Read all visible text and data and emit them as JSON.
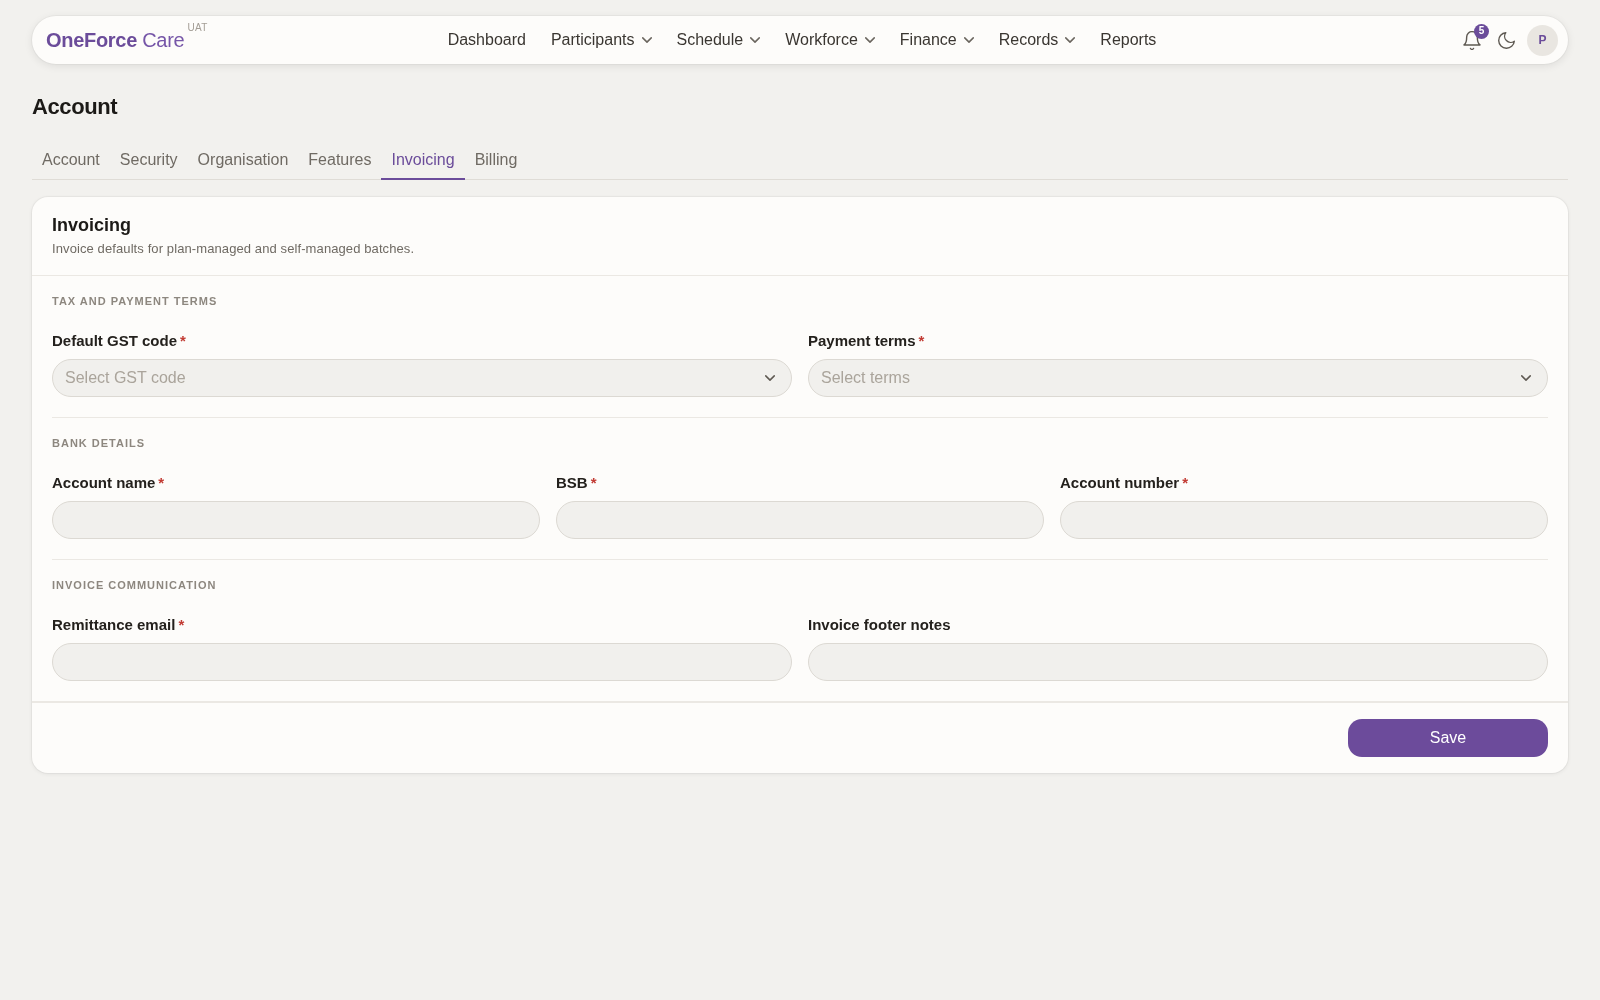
{
  "header": {
    "logo": "**OneForce** Care",
    "environment": "UAT",
    "nav": [
      {
        "label": "Dashboard",
        "has_menu": false
      },
      {
        "label": "Participants",
        "has_menu": true
      },
      {
        "label": "Schedule",
        "has_menu": true
      },
      {
        "label": "Workforce",
        "has_menu": true
      },
      {
        "label": "Finance",
        "has_menu": true
      },
      {
        "label": "Records",
        "has_menu": true
      },
      {
        "label": "Reports",
        "has_menu": false
      }
    ],
    "notification_count": "5",
    "avatar_initial": "P"
  },
  "page": {
    "title": "Account"
  },
  "tabs": [
    {
      "label": "Account",
      "selected": false
    },
    {
      "label": "Security",
      "selected": false
    },
    {
      "label": "Organisation",
      "selected": false
    },
    {
      "label": "Features",
      "selected": false
    },
    {
      "label": "Invoicing",
      "selected": true
    },
    {
      "label": "Billing",
      "selected": false
    }
  ],
  "card": {
    "title": "Invoicing",
    "description": "Invoice defaults for plan-managed and self-managed batches.",
    "sections": [
      {
        "heading": "TAX AND PAYMENT TERMS",
        "fields": [
          {
            "label": "Default GST code",
            "required_mark": "*",
            "kind": "select",
            "placeholder": "Select GST code"
          },
          {
            "label": "Payment terms",
            "required_mark": "*",
            "kind": "select",
            "placeholder": "Select terms"
          }
        ]
      },
      {
        "heading": "BANK DETAILS",
        "fields": [
          {
            "label": "Account name",
            "required_mark": "*",
            "kind": "text"
          },
          {
            "label": "BSB",
            "required_mark": "*",
            "kind": "text"
          },
          {
            "label": "Account number",
            "required_mark": "*",
            "kind": "text"
          }
        ]
      },
      {
        "heading": "INVOICE COMMUNICATION",
        "fields": [
          {
            "label": "Remittance email",
            "required_mark": "*",
            "kind": "text"
          },
          {
            "label": "Invoice footer notes",
            "kind": "text"
          }
        ]
      }
    ],
    "save_button": "Save"
  }
}
